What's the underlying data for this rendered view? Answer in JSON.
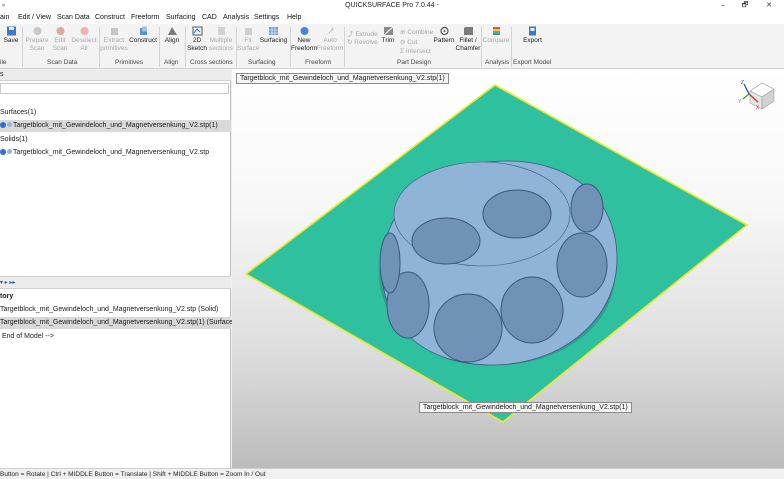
{
  "window": {
    "title": "QUICKSURFACE Pro 7.0.44 -",
    "app_icon_text": "ᵍᵗ",
    "minimize": "–",
    "maximize": "🗗",
    "close": "✕"
  },
  "menu": {
    "items": [
      "ain",
      "Edit / View",
      "Scan Data",
      "Construct",
      "Freeform",
      "Surfacing",
      "CAD",
      "Analysis",
      "Settings",
      "Help"
    ]
  },
  "ribbon": {
    "save": "Save",
    "prepare_1": "Prepare",
    "prepare_2": "Scan",
    "edit_1": "Edit",
    "edit_2": "Scan",
    "deselect_1": "Deselect",
    "deselect_2": "All",
    "extract_1": "Extract",
    "extract_2": "primitives",
    "construct": "Construct",
    "align": "Align",
    "sketch_1": "2D",
    "sketch_2": "Sketch",
    "multiple_1": "Multiple",
    "multiple_2": "sections",
    "fit_1": "Fit",
    "fit_2": "Surface",
    "surfacing": "Surfacing",
    "new_1": "New",
    "new_2": "Freeform",
    "auto_1": "Auto",
    "auto_2": "Freeform",
    "extrude": "Extrude",
    "revolve": "Revolve",
    "trim": "Trim",
    "combine": "Combine",
    "cut": "Cut",
    "intersect": "Intersect",
    "pattern": "Pattern",
    "fillet_1": "Fillet /",
    "fillet_2": "Chamfer",
    "compare": "Compare",
    "export": "Export",
    "groups": {
      "file": "ile",
      "scan_data": "Scan Data",
      "primitives": "Primitives",
      "align": "Align",
      "cross_sections": "Cross sections",
      "surfacing": "Surfacing",
      "freeform": "Freeform",
      "part_design": "Part Design",
      "analysis": "Analysis",
      "export_model": "Export Model"
    }
  },
  "left_panel": {
    "header": "s",
    "surfaces_label": "Surfaces(1)",
    "surface_item": "Targetblock_mit_Gewindeloch_und_Magnetversenkung_V2.stp(1)",
    "solids_label": "Solids(1)",
    "solid_item": "Targetblock_mit_Gewindeloch_und_Magnetversenkung_V2.stp",
    "history_title": "tory",
    "history_items": [
      "Targetblock_mit_Gewindeloch_und_Magnetversenkung_V2.stp (Solid)",
      "Targetblock_mit_Gewindeloch_und_Magnetversenkung_V2.stp(1) (Surface)",
      "End of Model -->"
    ],
    "nav_arrows": "▾ ▸ ▸▸"
  },
  "viewport": {
    "top_label": "Targetblock_mit_Gewindeloch_und_Magnetversenkung_V2.stp(1)",
    "bottom_label": "Targetblock_mit_Gewindeloch_und_Magnetversenkung_V2.stp(1)",
    "axis_z": "Z",
    "axis_x": "X",
    "axis_y": "Y",
    "colors": {
      "plane_fill": "#2fc19f",
      "plane_edge": "#e9ea25",
      "body_fill": "#8fb4d8",
      "body_stroke": "#3a5878",
      "pocket_fill": "#6f92b6"
    }
  },
  "status": {
    "text": "Button = Rotate | Ctrl + MIDDLE Button = Translate | Shift + MIDDLE Button = Zoom In / Out"
  }
}
